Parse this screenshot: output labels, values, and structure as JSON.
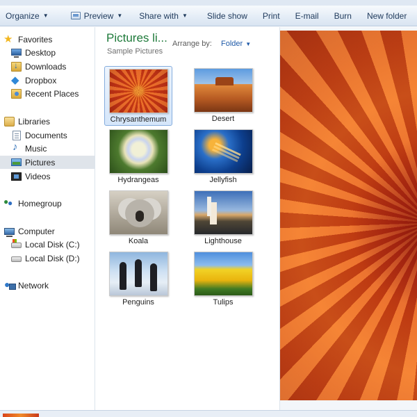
{
  "toolbar": {
    "organize": "Organize",
    "preview": "Preview",
    "share_with": "Share with",
    "slide_show": "Slide show",
    "print": "Print",
    "email": "E-mail",
    "burn": "Burn",
    "new_folder": "New folder"
  },
  "sidebar": {
    "favorites": {
      "label": "Favorites",
      "items": [
        "Desktop",
        "Downloads",
        "Dropbox",
        "Recent Places"
      ]
    },
    "libraries": {
      "label": "Libraries",
      "items": [
        "Documents",
        "Music",
        "Pictures",
        "Videos"
      ],
      "selected": "Pictures"
    },
    "homegroup": "Homegroup",
    "computer": {
      "label": "Computer",
      "items": [
        "Local Disk (C:)",
        "Local Disk (D:)"
      ]
    },
    "network": "Network"
  },
  "content": {
    "title": "Pictures li...",
    "subtitle": "Sample Pictures",
    "arrange_by_label": "Arrange by:",
    "arrange_by_value": "Folder",
    "thumbnails": [
      {
        "label": "Chrysanthemum",
        "selected": true
      },
      {
        "label": "Desert",
        "selected": false
      },
      {
        "label": "Hydrangeas",
        "selected": false
      },
      {
        "label": "Jellyfish",
        "selected": false
      },
      {
        "label": "Koala",
        "selected": false
      },
      {
        "label": "Lighthouse",
        "selected": false
      },
      {
        "label": "Penguins",
        "selected": false
      },
      {
        "label": "Tulips",
        "selected": false
      }
    ]
  },
  "colors": {
    "title_green": "#1e7a3a",
    "link_blue": "#1f5aa8",
    "selection_border": "#84acdd"
  }
}
